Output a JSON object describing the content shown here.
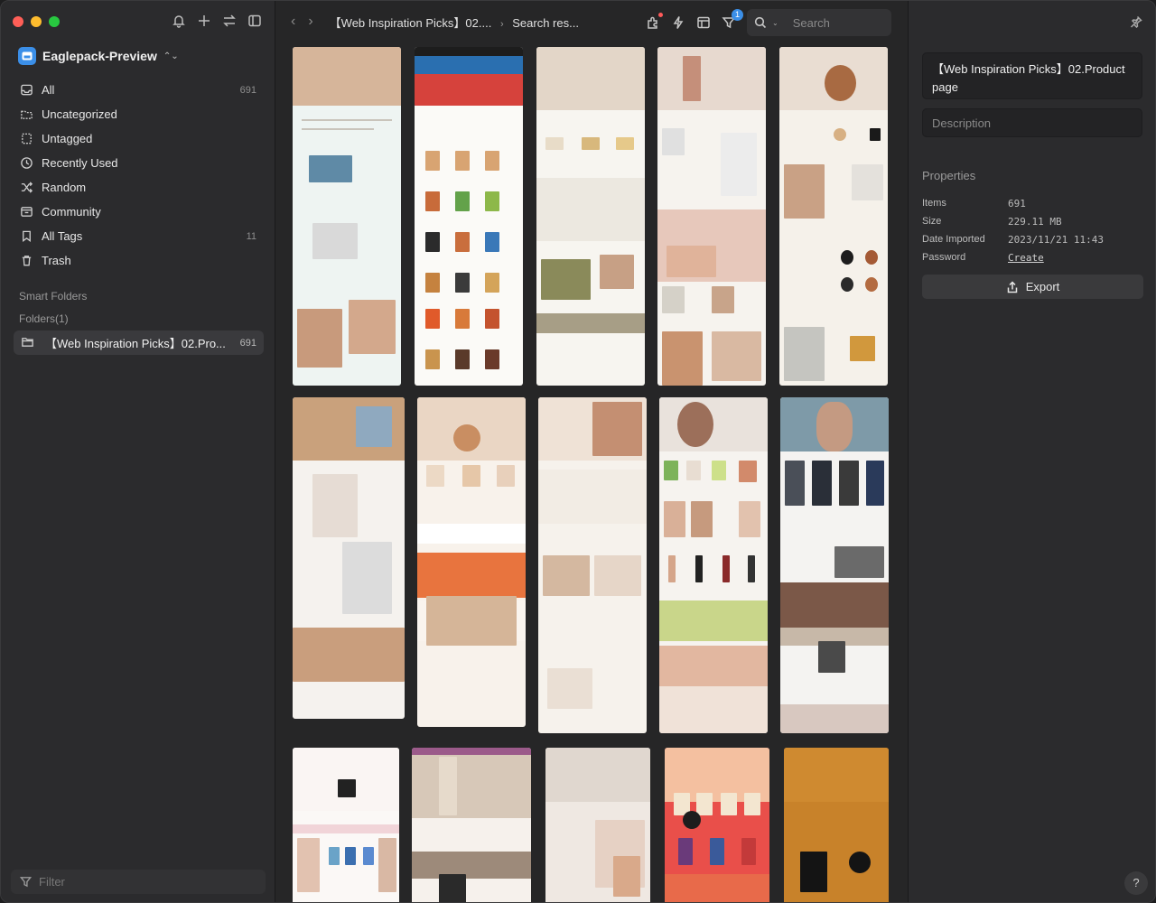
{
  "sidebar": {
    "library_name": "Eaglepack-Preview",
    "nav": [
      {
        "label": "All",
        "count": "691",
        "icon": "inbox-icon"
      },
      {
        "label": "Uncategorized",
        "count": "",
        "icon": "folder-icon"
      },
      {
        "label": "Untagged",
        "count": "",
        "icon": "untagged-icon"
      },
      {
        "label": "Recently Used",
        "count": "",
        "icon": "clock-icon"
      },
      {
        "label": "Random",
        "count": "",
        "icon": "shuffle-icon"
      },
      {
        "label": "Community",
        "count": "",
        "icon": "community-icon"
      },
      {
        "label": "All Tags",
        "count": "11",
        "icon": "bookmark-icon"
      },
      {
        "label": "Trash",
        "count": "",
        "icon": "trash-icon"
      }
    ],
    "smart_folders_label": "Smart Folders",
    "folders_label": "Folders(1)",
    "folder": {
      "label": "【Web Inspiration Picks】02.Pro...",
      "count": "691"
    },
    "filter_placeholder": "Filter"
  },
  "toolbar": {
    "breadcrumb_folder": "【Web Inspiration Picks】02....",
    "breadcrumb_current": "Search res...",
    "filter_badge": "1",
    "search_placeholder": "Search"
  },
  "inspector": {
    "title": "【Web Inspiration Picks】02.Product page",
    "description_placeholder": "Description",
    "properties_label": "Properties",
    "properties": [
      {
        "key": "Items",
        "value": "691"
      },
      {
        "key": "Size",
        "value": "229.11 MB"
      },
      {
        "key": "Date Imported",
        "value": "2023/11/21 11:43"
      },
      {
        "key": "Password",
        "value": "Create"
      }
    ],
    "export_label": "Export",
    "help_label": "?"
  },
  "colors": {
    "accent": "#3b8fe8",
    "sidebar_bg": "#2b2b2d",
    "content_bg": "#262627"
  }
}
